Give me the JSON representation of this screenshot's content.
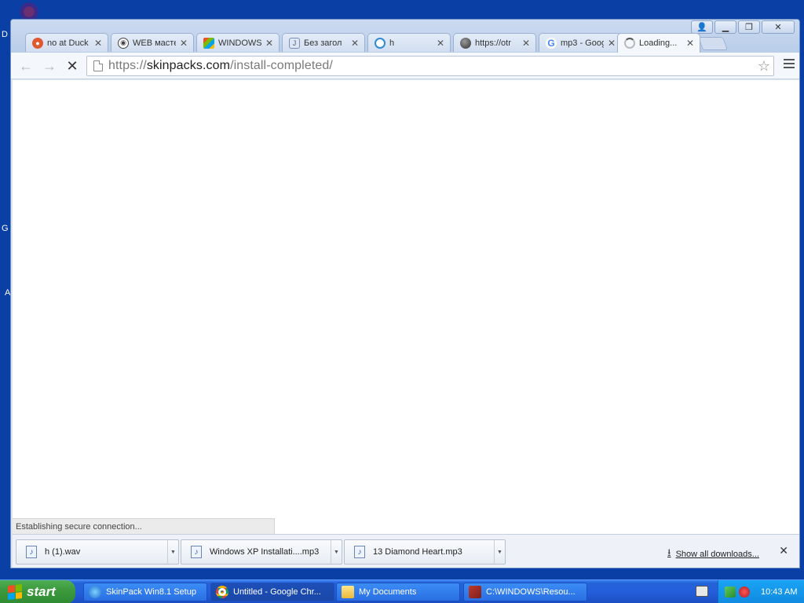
{
  "desktop": {
    "fragments": [
      "D",
      "G",
      "A"
    ]
  },
  "browser": {
    "tabs": [
      {
        "label": "no at Duck",
        "icon": "duckduckgo-icon",
        "color": "#de5833"
      },
      {
        "label": "WEB масте",
        "icon": "eye-logo-icon",
        "color": "#444444"
      },
      {
        "label": "WINDOWS",
        "icon": "windows-logo-icon",
        "color": "#3b6ad1"
      },
      {
        "label": "Без загол",
        "icon": "shield-page-icon",
        "color": "#7a8fb5"
      },
      {
        "label": "h",
        "icon": "ring-logo-icon",
        "color": "#2f8ad6"
      },
      {
        "label": "https://otr",
        "icon": "globe-icon",
        "color": "#555555"
      },
      {
        "label": "mp3 - Goog",
        "icon": "google-icon",
        "color": "#4285f4"
      },
      {
        "label": "Loading...",
        "icon": "loading-spinner-icon",
        "color": "#888888"
      }
    ],
    "close_glyph": "✕",
    "window_controls": {
      "user": "👤",
      "minimize": "▁",
      "maximize": "❐",
      "close": "✕"
    },
    "nav": {
      "back": "←",
      "forward": "→",
      "stop": "✕"
    },
    "url": {
      "scheme": "https://",
      "domain": "skinpacks.com",
      "path": "/install-completed/"
    },
    "status_text": "Establishing secure connection...",
    "downloads": [
      {
        "name": "h (1).wav"
      },
      {
        "name": "Windows XP Installati....mp3"
      },
      {
        "name": "13 Diamond Heart.mp3"
      }
    ],
    "show_all_downloads": "Show all downloads...",
    "download_glyph": "⭳",
    "file_glyph": "♪",
    "dropdown_glyph": "▼"
  },
  "taskbar": {
    "start_label": "start",
    "buttons": [
      {
        "label": "SkinPack Win8.1 Setup",
        "icon": "setup-icon"
      },
      {
        "label": "Untitled - Google Chr...",
        "icon": "chrome-icon"
      },
      {
        "label": "My Documents",
        "icon": "folder-icon"
      },
      {
        "label": "C:\\WINDOWS\\Resou...",
        "icon": "resource-hacker-icon"
      }
    ],
    "clock": "10:43 AM"
  },
  "colors": {
    "desktop": "#0a3fa6",
    "taskbar": "#245edb",
    "start": "#3d9a3f",
    "tray": "#108ae0"
  }
}
